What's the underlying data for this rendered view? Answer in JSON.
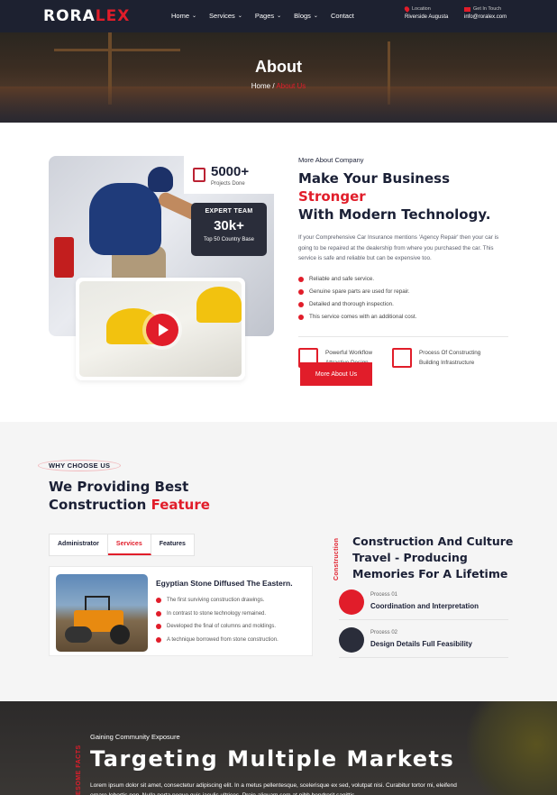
{
  "brand": {
    "logo_main": "RORA",
    "logo_accent": "LEX"
  },
  "nav": [
    {
      "label": "Home",
      "chevron": true
    },
    {
      "label": "Services",
      "chevron": true
    },
    {
      "label": "Pages",
      "chevron": true
    },
    {
      "label": "Blogs",
      "chevron": true
    },
    {
      "label": "Contact",
      "chevron": false
    }
  ],
  "header_contact": {
    "location_label": "Location",
    "location_value": "Riverside Augusta",
    "touch_label": "Get In Touch",
    "touch_value": "info@roralex.com"
  },
  "hero": {
    "title": "About",
    "crumb_home": "Home",
    "crumb_sep": "/",
    "crumb_current": "About Us"
  },
  "about": {
    "stat_number": "5000+",
    "stat_label": "Projects Done",
    "team_title": "EXPERT TEAM",
    "team_number": "30k+",
    "team_sub": "Top 50 Country Base",
    "kicker": "More About Company",
    "heading_part1": "Make Your Business ",
    "heading_accent": "Stronger",
    "heading_part2": "With Modern Technology.",
    "paragraph": "If your Comprehensive Car Insurance mentions 'Agency Repair' then your car is going to be repaired at the dealership from where you purchased the car. This service is safe and reliable but can be expensive too.",
    "checks": [
      "Reliable and safe service.",
      "Genuine spare parts are used for repair.",
      "Detailed and thorough inspection.",
      "This service comes with an additional cost."
    ],
    "features": [
      {
        "line1": "Powerful Workflow",
        "line2": "Attractive Design",
        "icon": "crane-icon"
      },
      {
        "line1": "Process Of Constructing",
        "line2": "Building Infrastructure",
        "icon": "building-icon"
      }
    ],
    "button": "More About Us"
  },
  "why": {
    "kicker": "WHY CHOOSE US",
    "heading_line1": "We Providing Best",
    "heading_line2_part": "Construction ",
    "heading_line2_accent": "Feature",
    "tabs": [
      "Administrator",
      "Services",
      "Features"
    ],
    "active_tab": "Services",
    "card_title": "Egyptian Stone Diffused The Eastern.",
    "card_list": [
      "The first surviving construction drawings.",
      "In contrast to stone technology remained.",
      "Developed the final of columns and moldings.",
      "A technique borrowed from stone construction."
    ],
    "vertical_label": "Construction",
    "right_heading": "Construction And Culture Travel - Producing Memories For A Lifetime",
    "processes": [
      {
        "label": "Process 01",
        "title": "Coordination and Interpretation",
        "color": "#e11d2a"
      },
      {
        "label": "Process 02",
        "title": "Design Details Full Feasibility",
        "color": "#2a2d3a"
      }
    ]
  },
  "facts": {
    "vertical_label": "ESOME FACTS",
    "kicker": "Gaining Community Exposure",
    "heading": "Targeting Multiple Markets",
    "paragraph": "Lorem ipsum dolor sit amet, consectetur adipiscing elit. In a metus pellentesque, scelerisque ex sed, volutpat nisi. Curabitur tortor mi, eleifend ornare lobortis non. Nulla porta neque quis iaculis ultrices. Proin aliquam sem at nibh hendrerit sagittis."
  },
  "colors": {
    "accent": "#e11d2a",
    "dark": "#1d2130",
    "heading": "#1b2036"
  }
}
